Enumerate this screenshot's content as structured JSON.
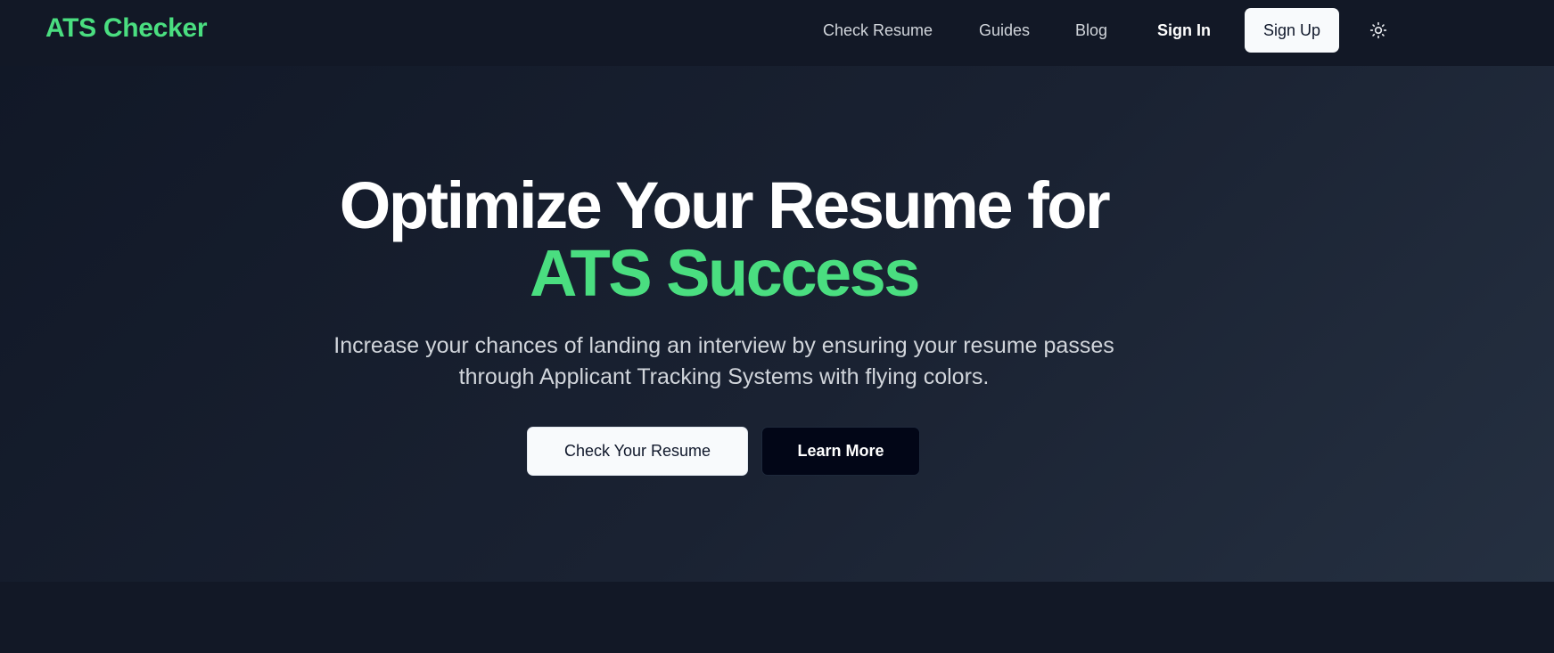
{
  "brand": {
    "name": "ATS Checker",
    "accent_color": "#4ade80"
  },
  "nav": {
    "links": [
      "Check Resume",
      "Guides",
      "Blog"
    ],
    "sign_in": "Sign In",
    "sign_up": "Sign Up",
    "theme_icon": "sun-icon"
  },
  "hero": {
    "headline_line1": "Optimize Your Resume for",
    "headline_line2": "ATS Success",
    "subtitle_line1": "Increase your chances of landing an interview by ensuring your resume passes",
    "subtitle_line2": "through Applicant Tracking Systems with flying colors.",
    "primary_cta": "Check Your Resume",
    "secondary_cta": "Learn More"
  }
}
